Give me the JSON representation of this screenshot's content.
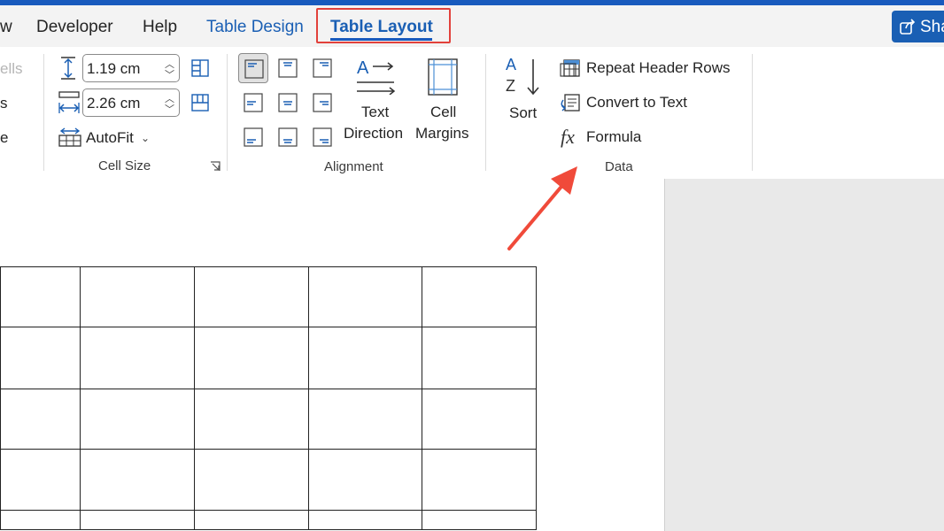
{
  "tabs": {
    "view_partial": "w",
    "developer": "Developer",
    "help": "Help",
    "table_design": "Table Design",
    "table_layout": "Table Layout",
    "share": "Sha"
  },
  "merge_group": {
    "item1": "ells",
    "item2": "s",
    "item3": "e"
  },
  "cell_size": {
    "height_value": "1.19 cm",
    "width_value": "2.26 cm",
    "autofit_label": "AutoFit",
    "group_label": "Cell Size"
  },
  "alignment": {
    "text_direction_l1": "Text",
    "text_direction_l2": "Direction",
    "cell_margins_l1": "Cell",
    "cell_margins_l2": "Margins",
    "group_label": "Alignment"
  },
  "data_group": {
    "sort_label": "Sort",
    "sort_a": "A",
    "sort_z": "Z",
    "repeat_header_rows": "Repeat Header Rows",
    "convert_to_text": "Convert to Text",
    "formula": "Formula",
    "formula_icon": "fx",
    "group_label": "Data"
  },
  "colors": {
    "accent": "#185abd",
    "highlight": "#e2413b",
    "arrow": "#f04a3a"
  }
}
